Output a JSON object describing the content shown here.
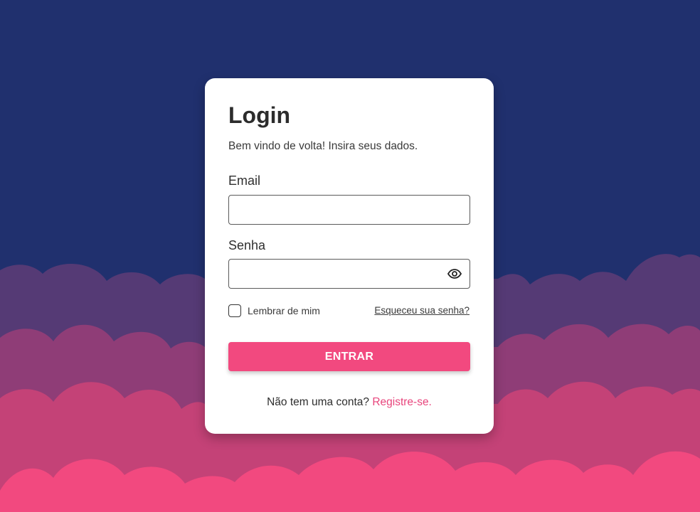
{
  "colors": {
    "background_top": "#20306e",
    "cloud_back": "#553a75",
    "cloud_mid": "#8f3d77",
    "cloud_front": "#c44277",
    "cloud_foreground": "#f2497f",
    "accent": "#f2497f",
    "link": "#e8457c"
  },
  "login": {
    "title": "Login",
    "subtitle": "Bem vindo de volta! Insira seus dados.",
    "email_label": "Email",
    "email_value": "",
    "password_label": "Senha",
    "password_value": "",
    "password_toggle_icon": "eye-icon",
    "remember_label": "Lembrar de mim",
    "remember_checked": false,
    "forgot_link": "Esqueceu sua senha?",
    "submit_label": "ENTRAR",
    "signup_prompt": "Não tem uma conta?",
    "signup_link": "Registre-se."
  }
}
